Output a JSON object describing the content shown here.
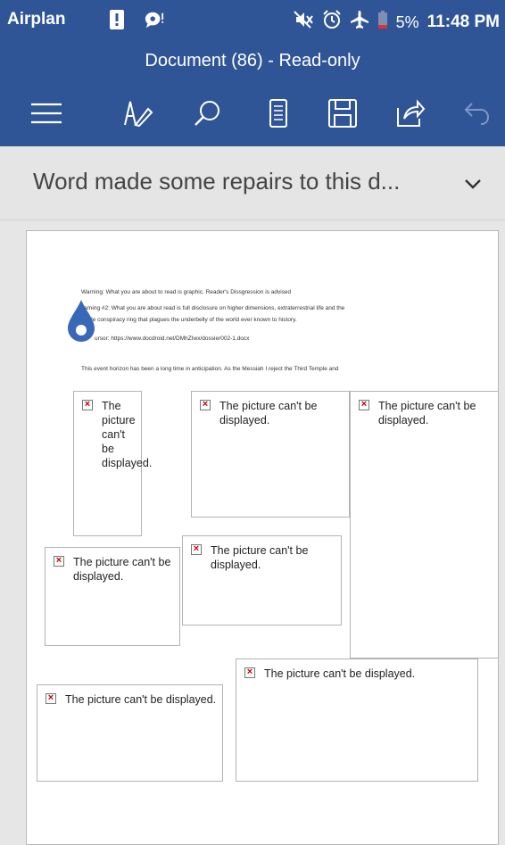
{
  "status_bar": {
    "carrier": "Airplan",
    "battery": "5%",
    "time": "11:48 PM",
    "icons": [
      "alert-icon",
      "chat-bubble-icon",
      "mute-icon",
      "alarm-icon",
      "airplane-icon",
      "battery-icon"
    ]
  },
  "title_bar": {
    "title": "Document (86) - Read-only"
  },
  "toolbar": {
    "icons": [
      "menu-icon",
      "draw-pen-icon",
      "search-icon",
      "mobile-view-icon",
      "save-icon",
      "share-icon",
      "undo-icon"
    ]
  },
  "banner": {
    "message": "Word made some repairs to this d..."
  },
  "document": {
    "lines": [
      "Warning: What you are about to read is graphic. Reader's Dissgression is advised",
      "arning #2: What you are about read is full disclosure on higher dimensions, extraterrestrial life and the",
      "t vile conspiracy ring that plagues the underbelly of the world ever known to history.",
      "ursor: https://www.docdroid.net/DMhZIwx/dossier002-1.docx",
      "This event horizon has been a long time in anticipation. As the Messiah I reject the Third Temple and"
    ],
    "pictures": [
      {
        "text": "The picture can't be displayed."
      },
      {
        "text": "The picture can't be displayed."
      },
      {
        "text": "The picture can't be displayed."
      },
      {
        "text": "The picture can't be displayed."
      },
      {
        "text": "The picture can't be displayed."
      },
      {
        "text": "The picture can't be displayed."
      },
      {
        "text": "The picture can't be displayed."
      }
    ]
  },
  "colors": {
    "app_blue": "#2f5597",
    "banner_bg": "#e5e5e5",
    "cursor_blue": "#3a68b8",
    "error_red": "#c00000"
  }
}
